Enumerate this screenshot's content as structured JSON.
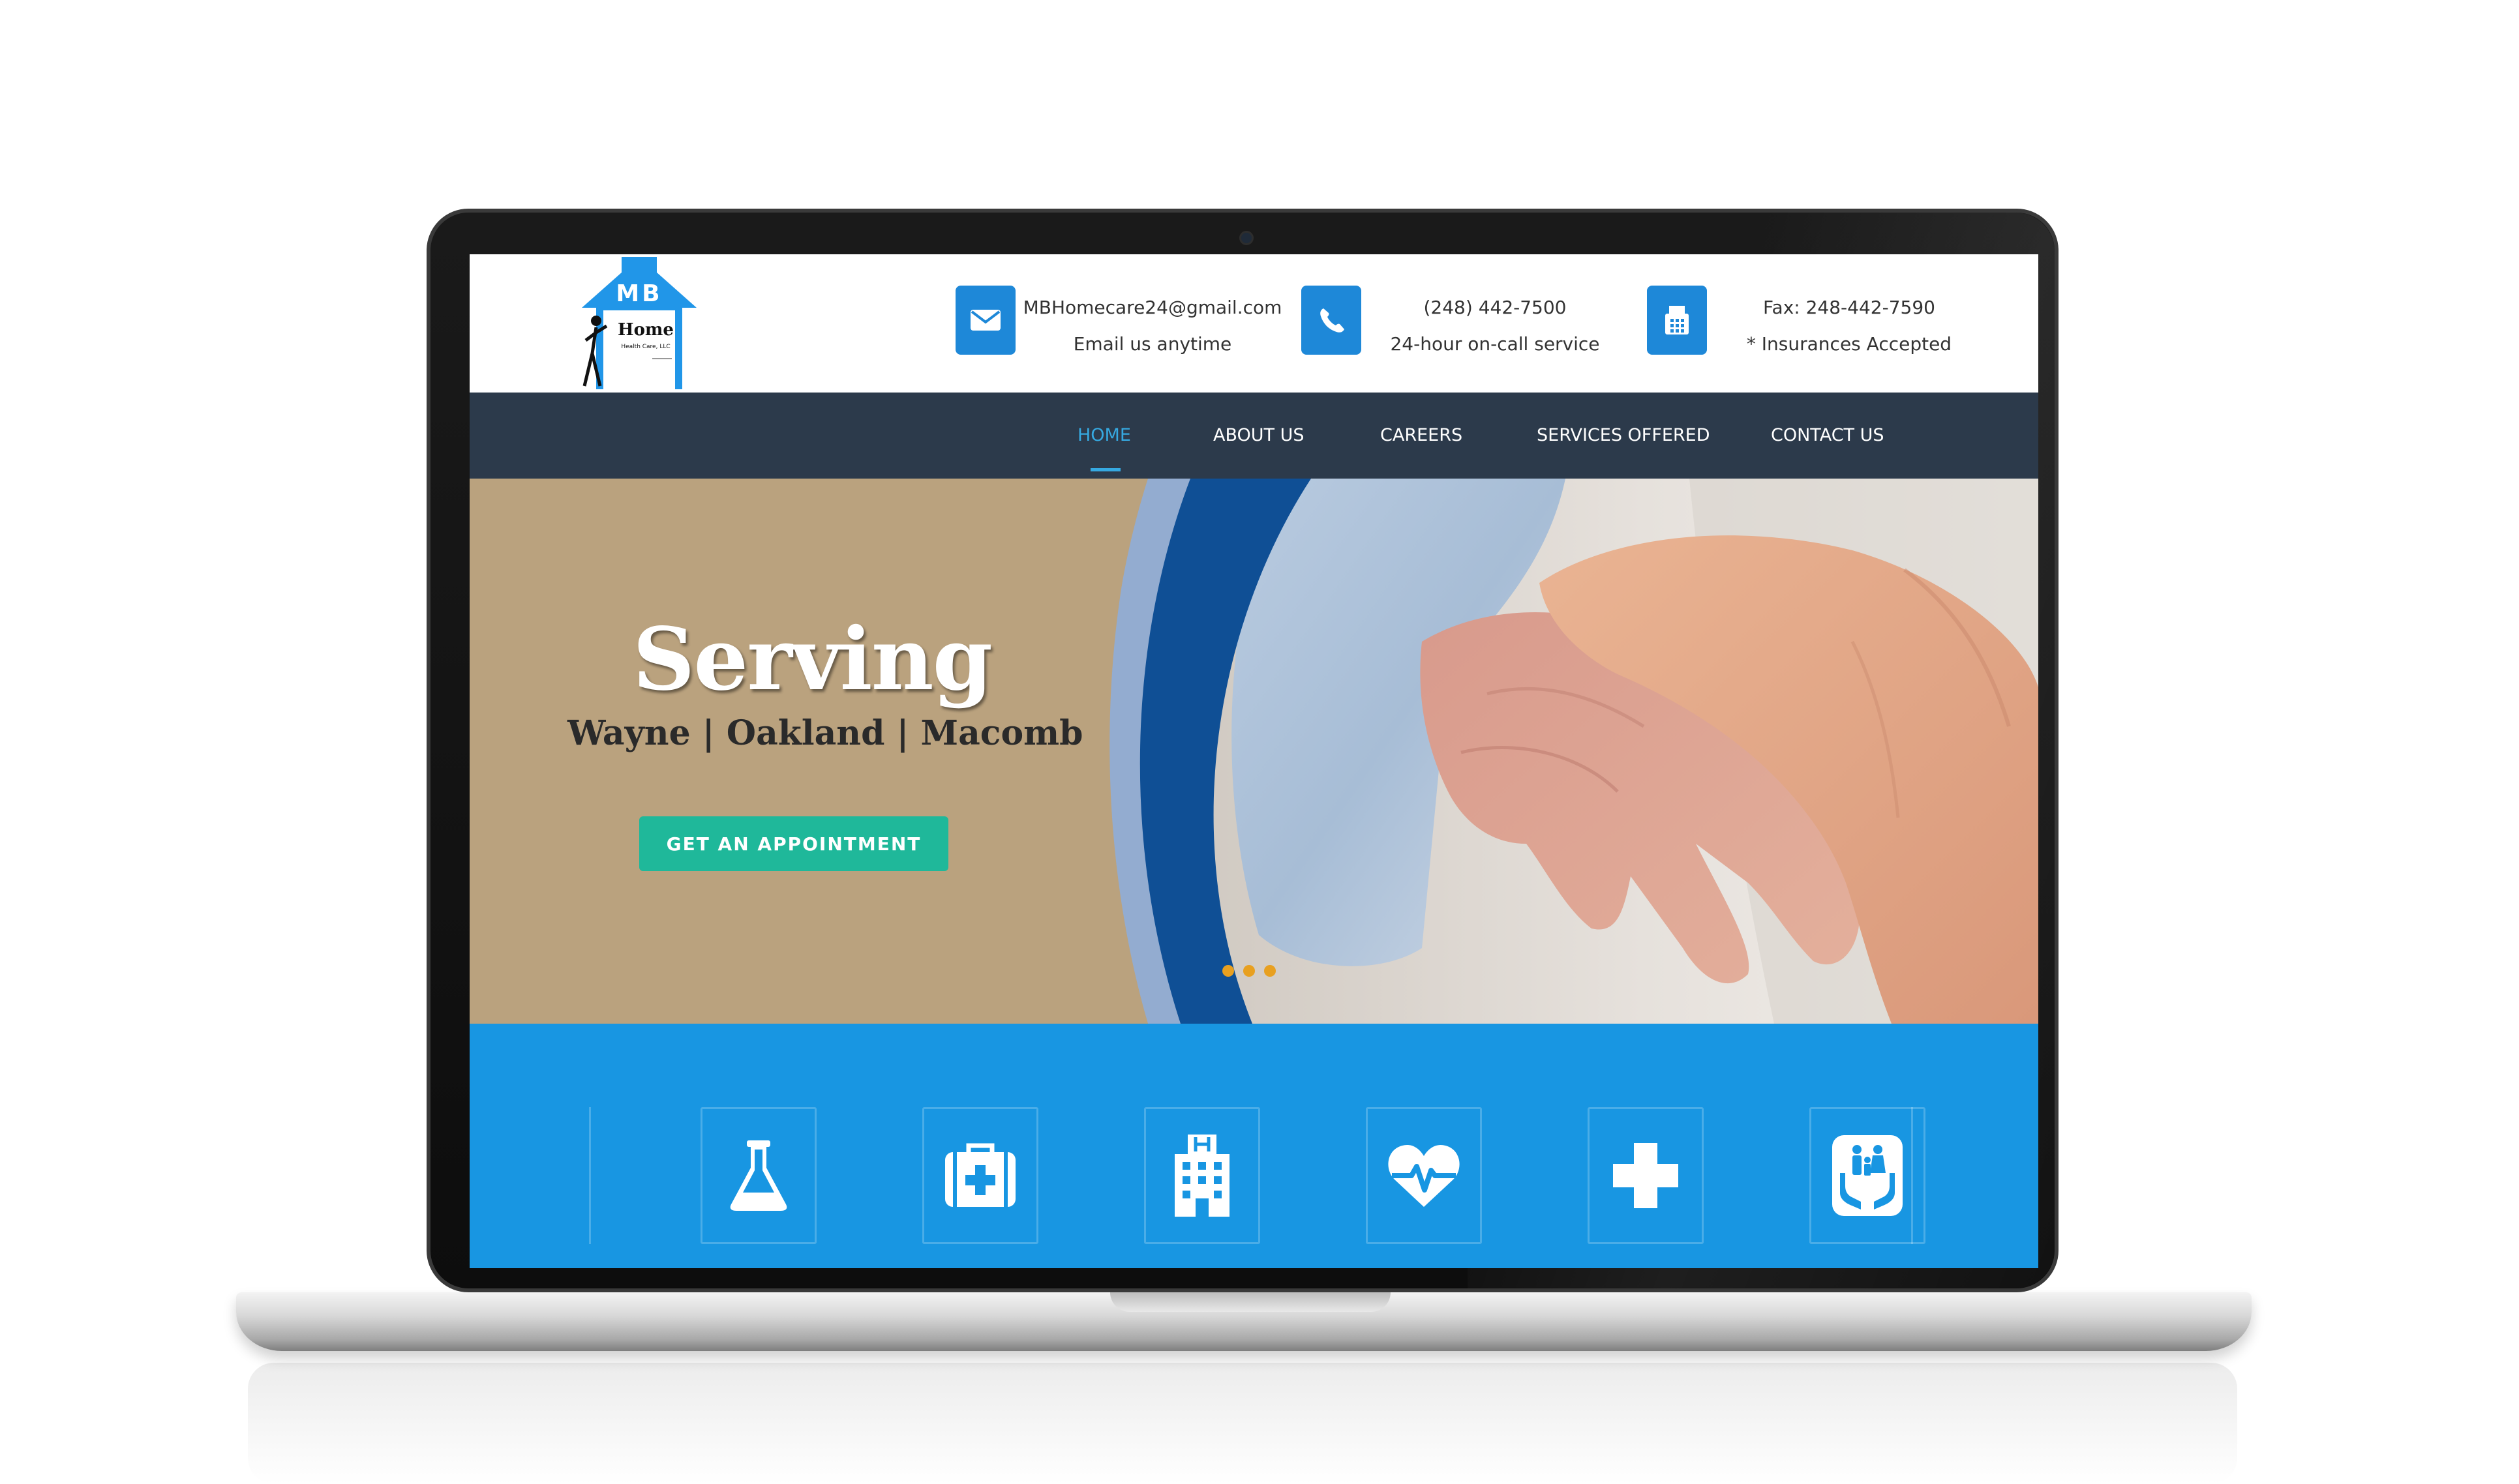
{
  "logo": {
    "initials": "MB",
    "name": "Home",
    "sub": "Health Care, LLC"
  },
  "header": {
    "email": {
      "icon": "envelope-icon",
      "line1": "MBHomecare24@gmail.com",
      "line2": "Email us anytime"
    },
    "phone": {
      "icon": "phone-icon",
      "line1": "(248) 442-7500",
      "line2": "24-hour on-call service"
    },
    "fax": {
      "icon": "fax-icon",
      "line1": "Fax: 248-442-7590",
      "line2": "* Insurances Accepted"
    }
  },
  "nav": {
    "items": [
      {
        "label": "HOME",
        "active": true
      },
      {
        "label": "ABOUT US",
        "active": false
      },
      {
        "label": "CAREERS",
        "active": false
      },
      {
        "label": "SERVICES OFFERED",
        "active": false
      },
      {
        "label": "CONTACT US",
        "active": false
      }
    ]
  },
  "hero": {
    "title": "Serving",
    "subtitle": "Wayne | Oakland | Macomb",
    "cta_label": "GET AN APPOINTMENT",
    "slides": 3
  },
  "services": {
    "icons": [
      "flask-icon",
      "first-aid-kit-icon",
      "hospital-building-icon",
      "heart-pulse-icon",
      "medical-cross-icon",
      "family-care-icon"
    ]
  },
  "colors": {
    "brand_blue": "#1e88d8",
    "nav_bg": "#2c3a4b",
    "nav_active": "#36a9e1",
    "hero_bg": "#baa27e",
    "cta_green": "#1fb89a",
    "services_bg": "#1896e2",
    "slider_dot": "#e8a020"
  }
}
